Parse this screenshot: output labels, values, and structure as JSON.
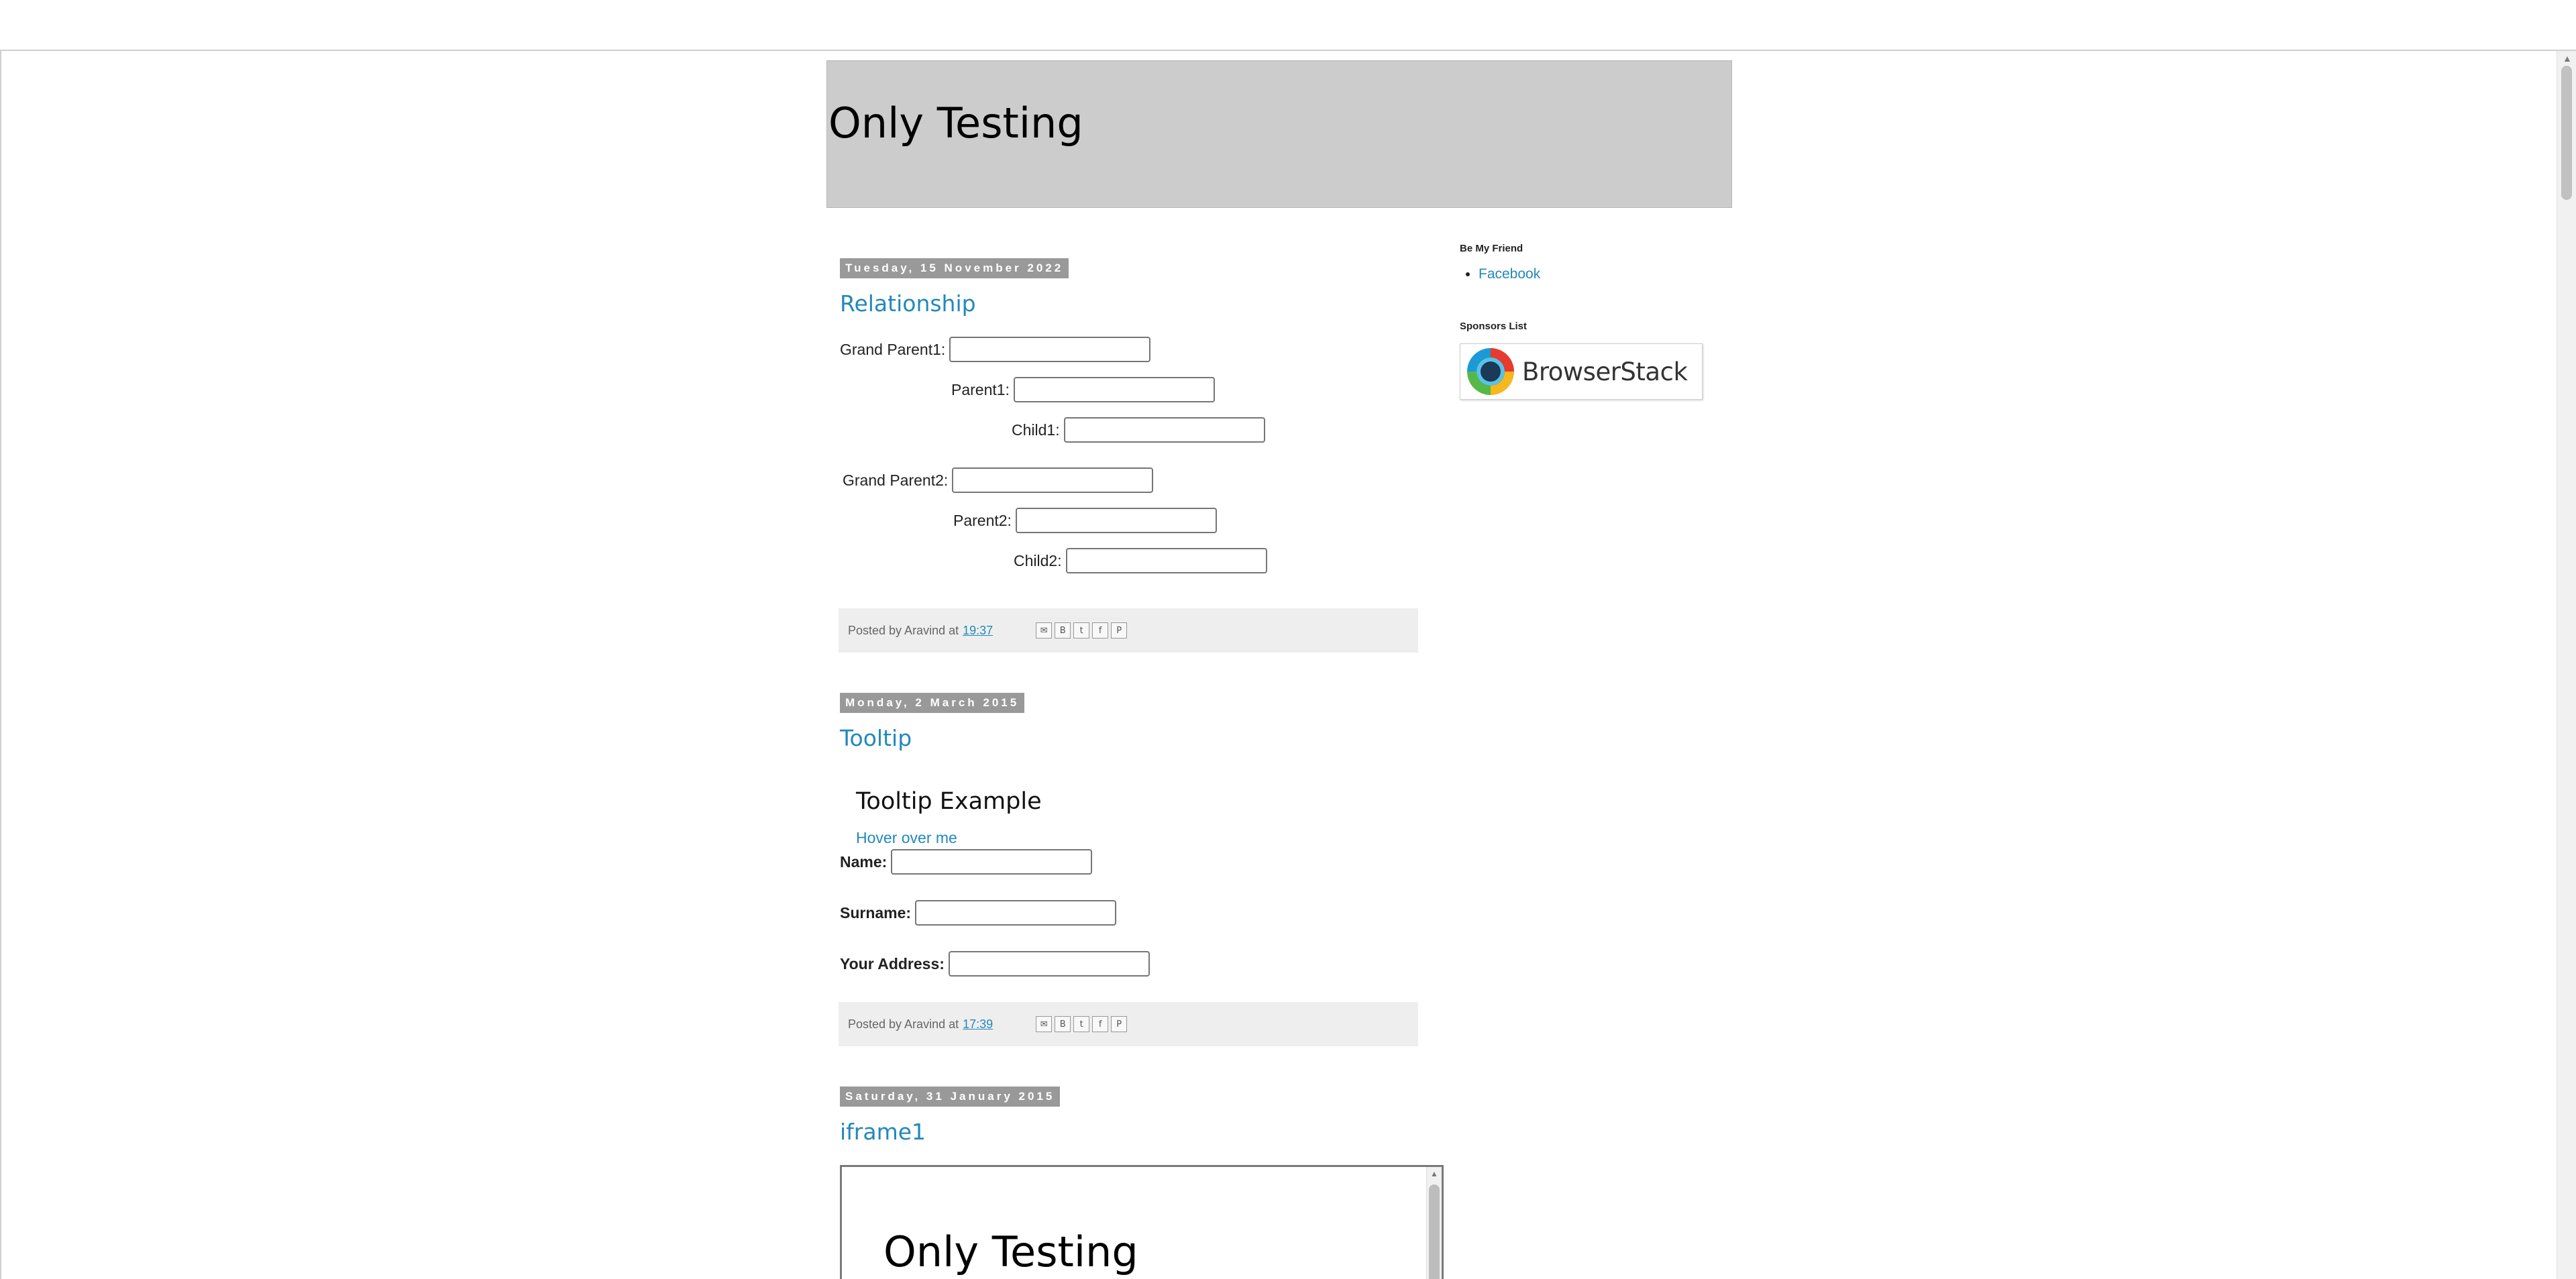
{
  "blog": {
    "title": "Only Testing"
  },
  "posts": [
    {
      "date": "Tuesday, 15 November 2022",
      "title": "Relationship",
      "fields": [
        {
          "label": "Grand Parent1:",
          "value": ""
        },
        {
          "label": "Parent1:",
          "value": ""
        },
        {
          "label": "Child1:",
          "value": ""
        },
        {
          "label": "Grand Parent2:",
          "value": ""
        },
        {
          "label": "Parent2:",
          "value": ""
        },
        {
          "label": "Child2:",
          "value": ""
        }
      ],
      "footer": {
        "posted_by": "Posted by Aravind at",
        "time": "19:37"
      }
    },
    {
      "date": "Monday, 2 March 2015",
      "title": "Tooltip",
      "heading": "Tooltip Example",
      "hover_link": "Hover over me",
      "fields": [
        {
          "label": "Name:",
          "value": ""
        },
        {
          "label": "Surname:",
          "value": ""
        },
        {
          "label": "Your Address:",
          "value": ""
        }
      ],
      "footer": {
        "posted_by": "Posted by Aravind at",
        "time": "17:39"
      }
    },
    {
      "date": "Saturday, 31 January 2015",
      "title": "iframe1",
      "iframe_title": "Only Testing"
    }
  ],
  "sidebar": {
    "friend_title": "Be My Friend",
    "friend_links": [
      "Facebook"
    ],
    "sponsors_title": "Sponsors List",
    "sponsor_logo_text": "BrowserStack"
  },
  "share_icons": [
    "email-icon",
    "blogthis-icon",
    "twitter-icon",
    "facebook-icon",
    "pinterest-icon"
  ]
}
